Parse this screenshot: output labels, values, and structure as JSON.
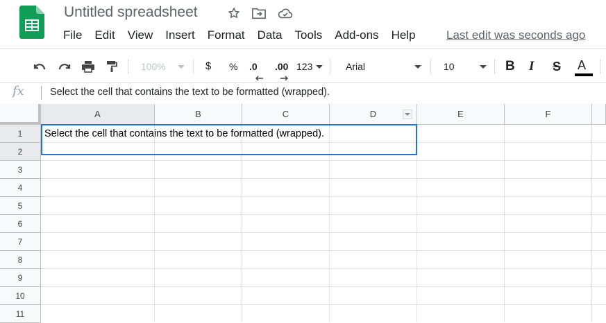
{
  "header": {
    "title": "Untitled spreadsheet",
    "last_edit": "Last edit was seconds ago",
    "icons": [
      "star-icon",
      "move-to-folder-icon",
      "cloud-saved-icon"
    ]
  },
  "menu": [
    "File",
    "Edit",
    "View",
    "Insert",
    "Format",
    "Data",
    "Tools",
    "Add-ons",
    "Help"
  ],
  "toolbar": {
    "zoom": "100%",
    "currency": "$",
    "percent": "%",
    "decrease_decimal": ".0",
    "increase_decimal": ".00",
    "more_formats": "123",
    "font": "Arial",
    "font_size": "10",
    "bold": "B",
    "italic": "I",
    "strike": "S",
    "text_color": "A"
  },
  "formula_bar": {
    "fx": "fx",
    "content": "Select the cell that contains the text to be formatted (wrapped)."
  },
  "grid": {
    "columns": [
      "A",
      "B",
      "C",
      "D",
      "E",
      "F"
    ],
    "rows": [
      "1",
      "2",
      "3",
      "4",
      "5",
      "6",
      "7",
      "8",
      "9",
      "10",
      "11"
    ],
    "cell_a1": "Select the cell that contains the text to be formatted (wrapped)."
  },
  "colors": {
    "accent": "#1a73e8",
    "sheets_green": "#0f9d58",
    "header_bg": "#f8f9fa"
  }
}
